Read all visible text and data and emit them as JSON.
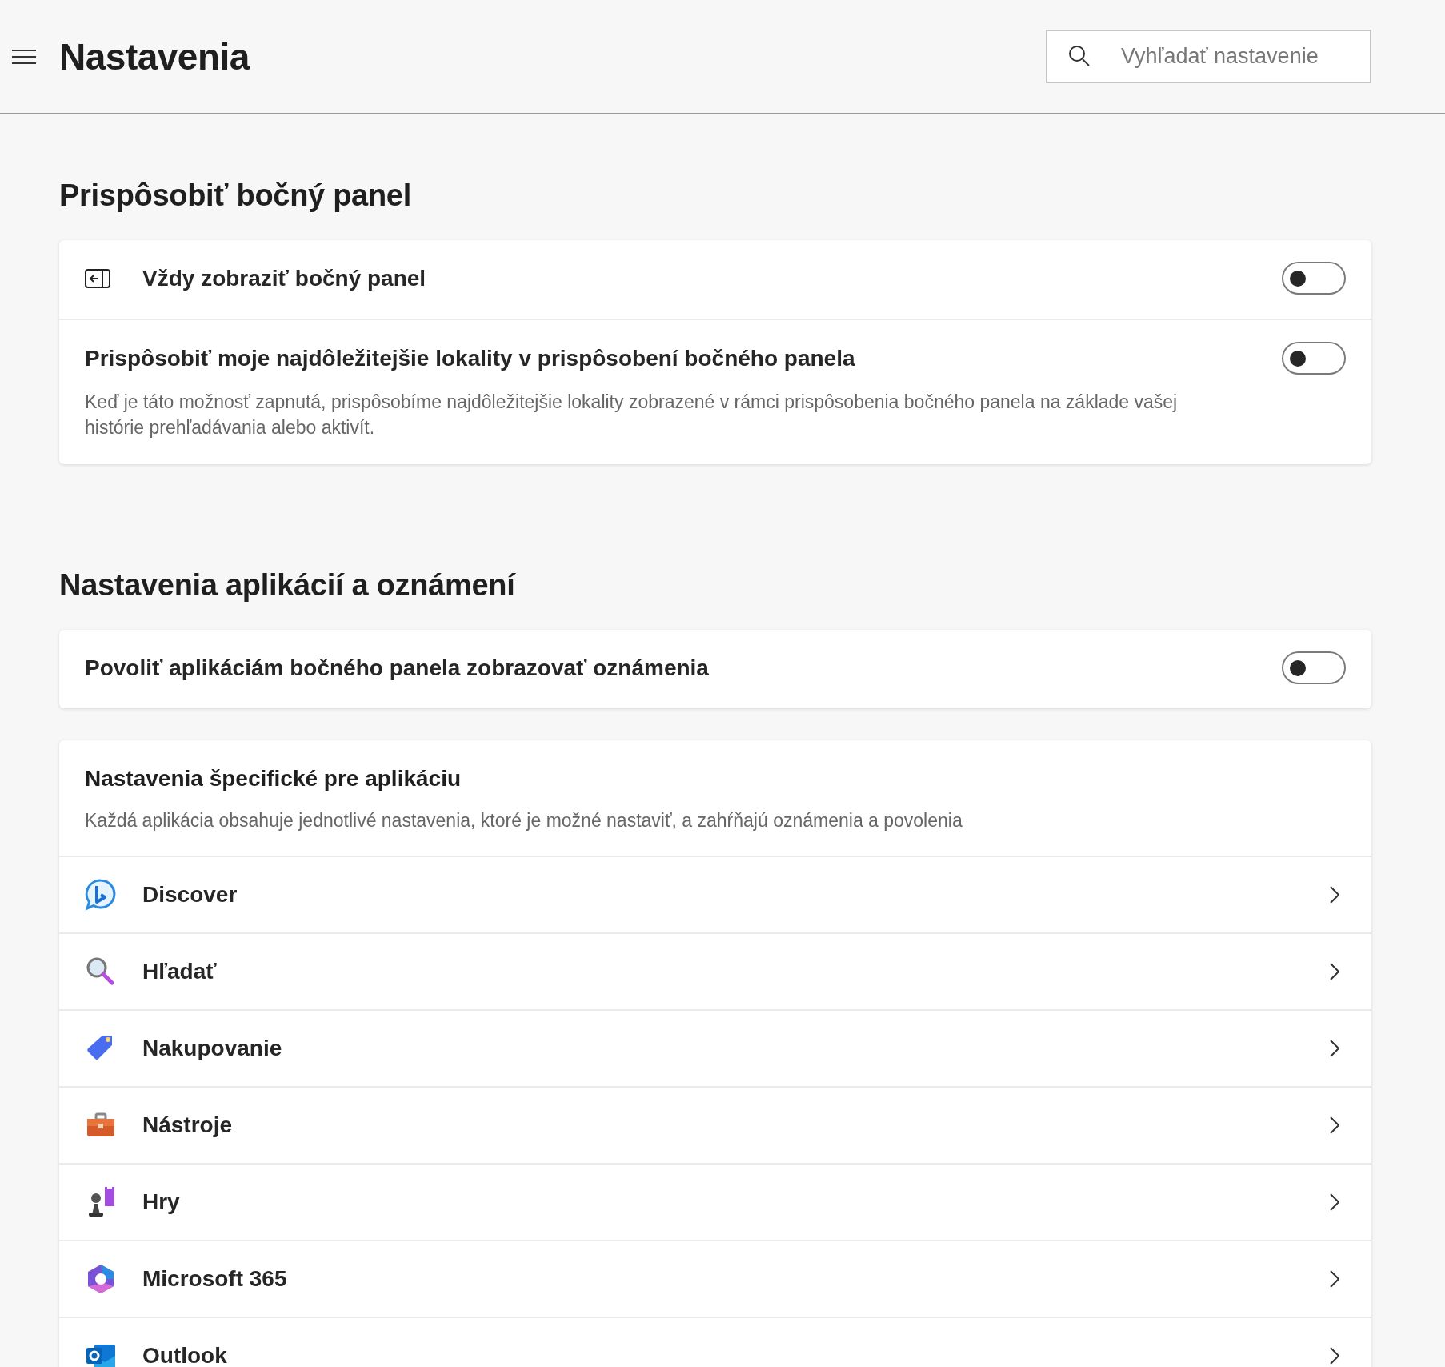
{
  "header": {
    "title": "Nastavenia",
    "search": {
      "placeholder": "Vyhľadať nastavenie"
    }
  },
  "sections": [
    {
      "heading": "Prispôsobiť bočný panel",
      "cards": [
        {
          "rows": [
            {
              "kind": "icon_toggle",
              "label": "Vždy zobraziť bočný panel",
              "on": false
            },
            {
              "kind": "toggle",
              "label": "Prispôsobiť moje najdôležitejšie lokality v prispôsobení bočného panela",
              "description": "Keď je táto možnosť zapnutá, prispôsobíme najdôležitejšie lokality zobrazené v rámci prispôsobenia bočného panela na základe vašej histórie prehľadávania alebo aktivít.",
              "on": false
            }
          ]
        }
      ]
    },
    {
      "heading": "Nastavenia aplikácií a oznámení",
      "cards": [
        {
          "rows": [
            {
              "kind": "toggle",
              "label": "Povoliť aplikáciám bočného panela zobrazovať oznámenia",
              "on": false
            }
          ]
        },
        {
          "title": "Nastavenia špecifické pre aplikáciu",
          "description": "Každá aplikácia obsahuje jednotlivé nastavenia, ktoré je možné nastaviť, a zahŕňajú oznámenia a povolenia",
          "rows": [
            {
              "kind": "discover",
              "label": "Discover"
            },
            {
              "kind": "search",
              "label": "Hľadať"
            },
            {
              "kind": "shopping",
              "label": "Nakupovanie"
            },
            {
              "kind": "tools",
              "label": "Nástroje"
            },
            {
              "kind": "games",
              "label": "Hry"
            },
            {
              "kind": "m365",
              "label": "Microsoft 365"
            },
            {
              "kind": "outlook",
              "label": "Outlook"
            }
          ]
        }
      ]
    }
  ]
}
